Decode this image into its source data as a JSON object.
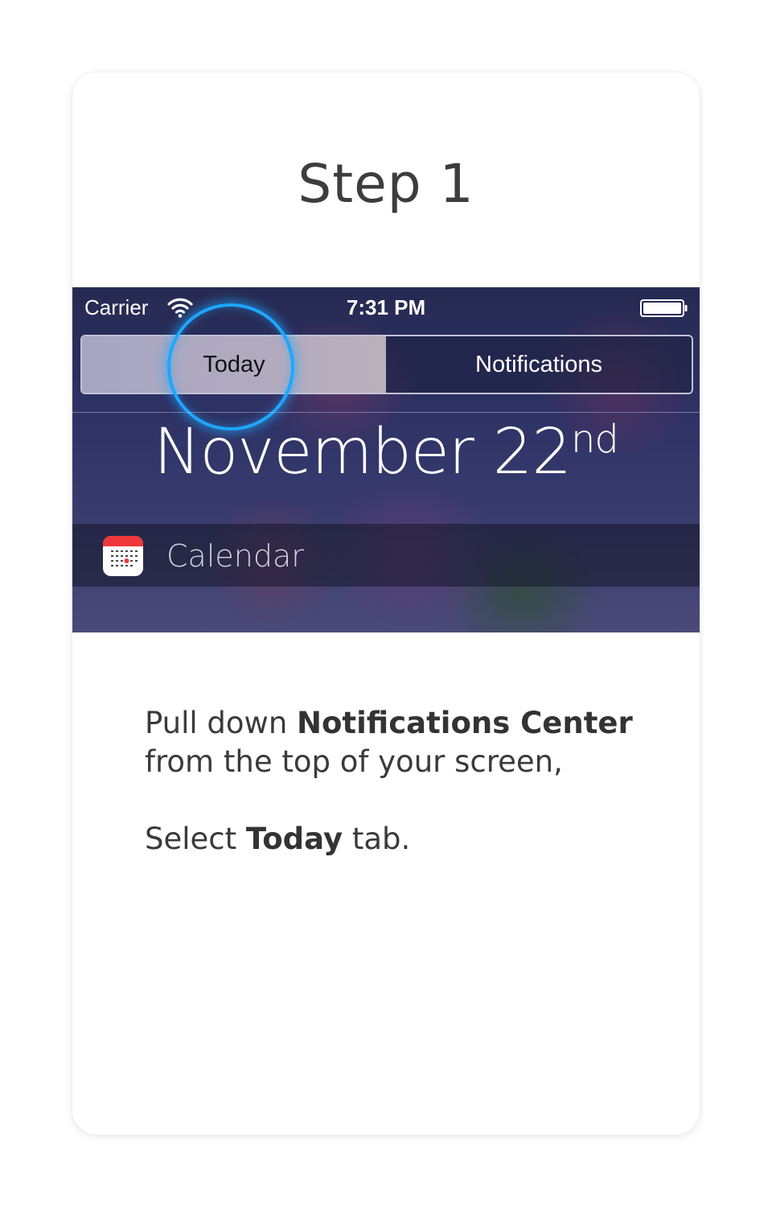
{
  "step": {
    "title": "Step 1"
  },
  "screenshot": {
    "status_bar": {
      "carrier": "Carrier",
      "time": "7:31 PM"
    },
    "tabs": [
      {
        "label": "Today",
        "selected": true
      },
      {
        "label": "Notifications",
        "selected": false
      }
    ],
    "date": {
      "month_day": "November 22",
      "suffix": "nd"
    },
    "calendar_widget": {
      "label": "Calendar"
    },
    "highlight_color": "#1ea6ff"
  },
  "instructions": {
    "line1_prefix": "Pull down ",
    "line1_bold": "Notifications Center",
    "line2": "from the top of your screen,",
    "line3_prefix": "Select ",
    "line3_bold": "Today",
    "line3_suffix": " tab."
  }
}
